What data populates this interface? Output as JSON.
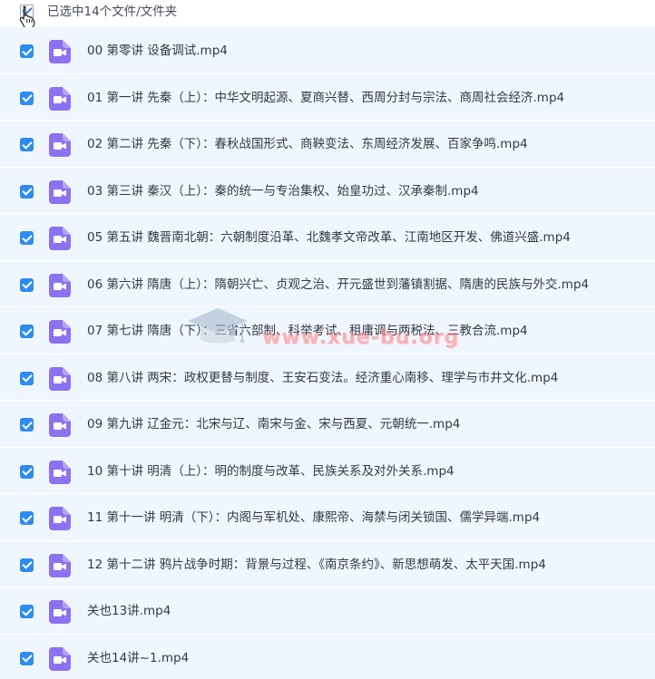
{
  "header": {
    "selection_summary": "已选中14个文件/文件夹"
  },
  "files": [
    {
      "name": "00 第零讲 设备调试.mp4",
      "icon": "video-file-icon",
      "checked": true
    },
    {
      "name": "01 第一讲 先秦（上）：中华文明起源、夏商兴替、西周分封与宗法、商周社会经济.mp4",
      "icon": "video-file-icon",
      "checked": true
    },
    {
      "name": "02 第二讲 先秦（下）：春秋战国形式、商鞅变法、东周经济发展、百家争鸣.mp4",
      "icon": "video-file-icon",
      "checked": true
    },
    {
      "name": "03 第三讲 秦汉（上）：秦的统一与专治集权、始皇功过、汉承秦制.mp4",
      "icon": "video-file-icon",
      "checked": true
    },
    {
      "name": "05 第五讲 魏晋南北朝：六朝制度沿革、北魏孝文帝改革、江南地区开发、佛道兴盛.mp4",
      "icon": "video-file-icon",
      "checked": true
    },
    {
      "name": "06 第六讲 隋唐（上）：隋朝兴亡、贞观之治、开元盛世到藩镇割据、隋唐的民族与外交.mp4",
      "icon": "video-file-icon",
      "checked": true
    },
    {
      "name": "07 第七讲 隋唐（下）：三省六部制、科举考试、租庸调与两税法、三教合流.mp4",
      "icon": "video-file-icon",
      "checked": true
    },
    {
      "name": "08 第八讲 两宋：政权更替与制度、王安石变法。经济重心南移、理学与市井文化.mp4",
      "icon": "video-file-icon",
      "checked": true
    },
    {
      "name": "09 第九讲 辽金元：北宋与辽、南宋与金、宋与西夏、元朝统一.mp4",
      "icon": "video-file-icon",
      "checked": true
    },
    {
      "name": "10 第十讲 明清（上）：明的制度与改革、民族关系及对外关系.mp4",
      "icon": "video-file-icon",
      "checked": true
    },
    {
      "name": "11 第十一讲 明清（下）：内阁与军机处、康熙帝、海禁与闭关锁国、儒学异端.mp4",
      "icon": "video-file-icon",
      "checked": true
    },
    {
      "name": "12 第十二讲 鸦片战争时期：背景与过程、《南京条约》、新思想萌发、太平天国.mp4",
      "icon": "video-file-icon",
      "checked": true
    },
    {
      "name": "关也13讲.mp4",
      "icon": "video-file-icon",
      "checked": true
    },
    {
      "name": "关也14讲~1.mp4",
      "icon": "video-file-icon",
      "checked": true
    }
  ],
  "watermark": {
    "text": "www.xue-bu.org",
    "icon": "graduation-cap-icon"
  },
  "colors": {
    "row_background": "#f0f6fe",
    "checkbox_checked": "#2d8cf0",
    "video_icon": "#8a72f0",
    "watermark": "#ff7a7a"
  }
}
